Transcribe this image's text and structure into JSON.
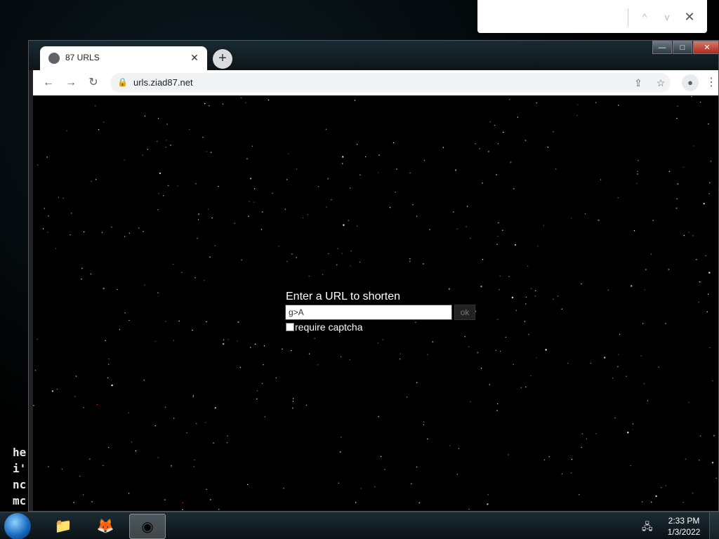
{
  "terminal": {
    "lines": [
      "he",
      "i'",
      "nc",
      "mc"
    ]
  },
  "findbar": {
    "value": "",
    "prev_label": "^",
    "next_label": "v",
    "close_label": "✕"
  },
  "browser": {
    "tab_title": "87 URLS",
    "tab_close": "✕",
    "new_tab": "+",
    "url": "urls.ziad87.net",
    "window_controls": {
      "minimize": "—",
      "maximize": "□",
      "close": "✕"
    }
  },
  "page": {
    "heading": "Enter a URL to shorten",
    "url_input_value": "g>A",
    "ok_label": "ok",
    "captcha_label": "require captcha"
  },
  "taskbar": {
    "time": "2:33 PM",
    "date": "1/3/2022"
  },
  "colors": {
    "page_background": "#000000",
    "text": "#ffffff",
    "star": "#ffffff",
    "star_red": "#ff3b3b"
  }
}
